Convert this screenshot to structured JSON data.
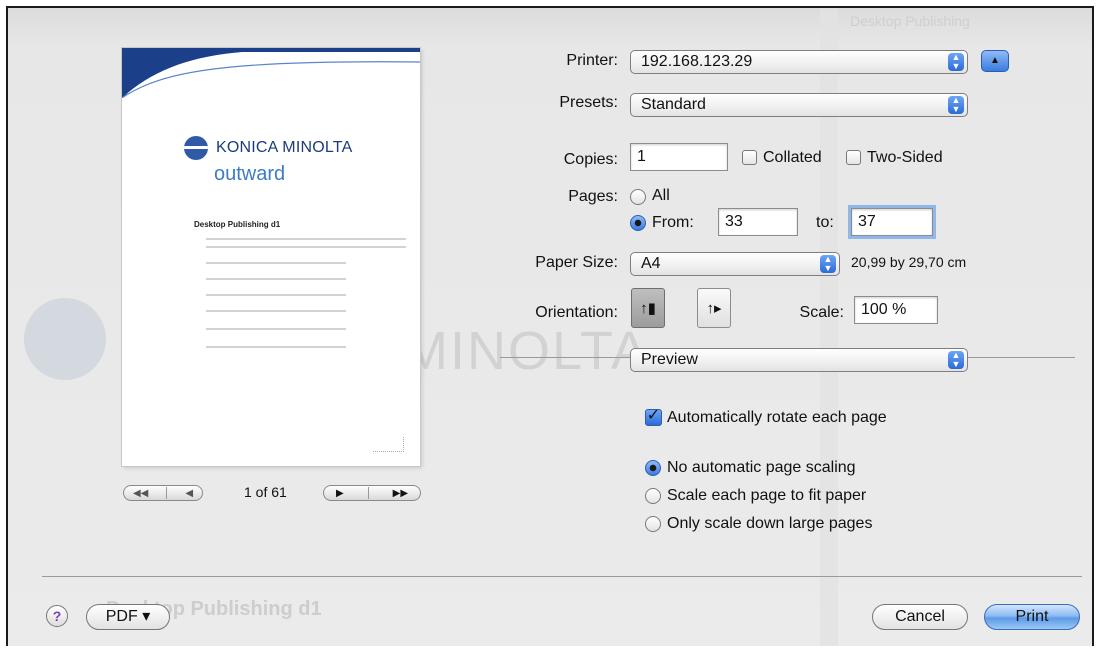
{
  "printer": {
    "label": "Printer:",
    "value": "192.168.123.29"
  },
  "presets": {
    "label": "Presets:",
    "value": "Standard"
  },
  "copies": {
    "label": "Copies:",
    "value": "1",
    "collated_label": "Collated",
    "two_sided_label": "Two-Sided"
  },
  "pages": {
    "label": "Pages:",
    "all_label": "All",
    "from_label": "From:",
    "from_value": "33",
    "to_label": "to:",
    "to_value": "37"
  },
  "paper_size": {
    "label": "Paper Size:",
    "value": "A4",
    "dimensions": "20,99 by 29,70 cm"
  },
  "orientation": {
    "label": "Orientation:",
    "scale_label": "Scale:",
    "scale_value": "100 %"
  },
  "section_menu": {
    "value": "Preview"
  },
  "preview_options": {
    "auto_rotate_label": "Automatically rotate each page",
    "scaling_options": [
      "No automatic page scaling",
      "Scale each page to fit paper",
      "Only scale down large pages"
    ]
  },
  "navigation": {
    "page_counter": "1 of 61"
  },
  "buttons": {
    "help": "?",
    "pdf": "PDF ▾",
    "cancel": "Cancel",
    "print": "Print"
  },
  "preview_doc": {
    "brand": "KONICA MINOLTA",
    "subbrand": "outward",
    "title": "Desktop Publishing d1"
  },
  "background": {
    "brand": "MINOLTA",
    "heading": "Desktop Publishing d1",
    "sidebar_items": [
      "Desktop Publishing",
      "",
      "",
      "",
      "",
      "",
      "",
      ""
    ]
  }
}
